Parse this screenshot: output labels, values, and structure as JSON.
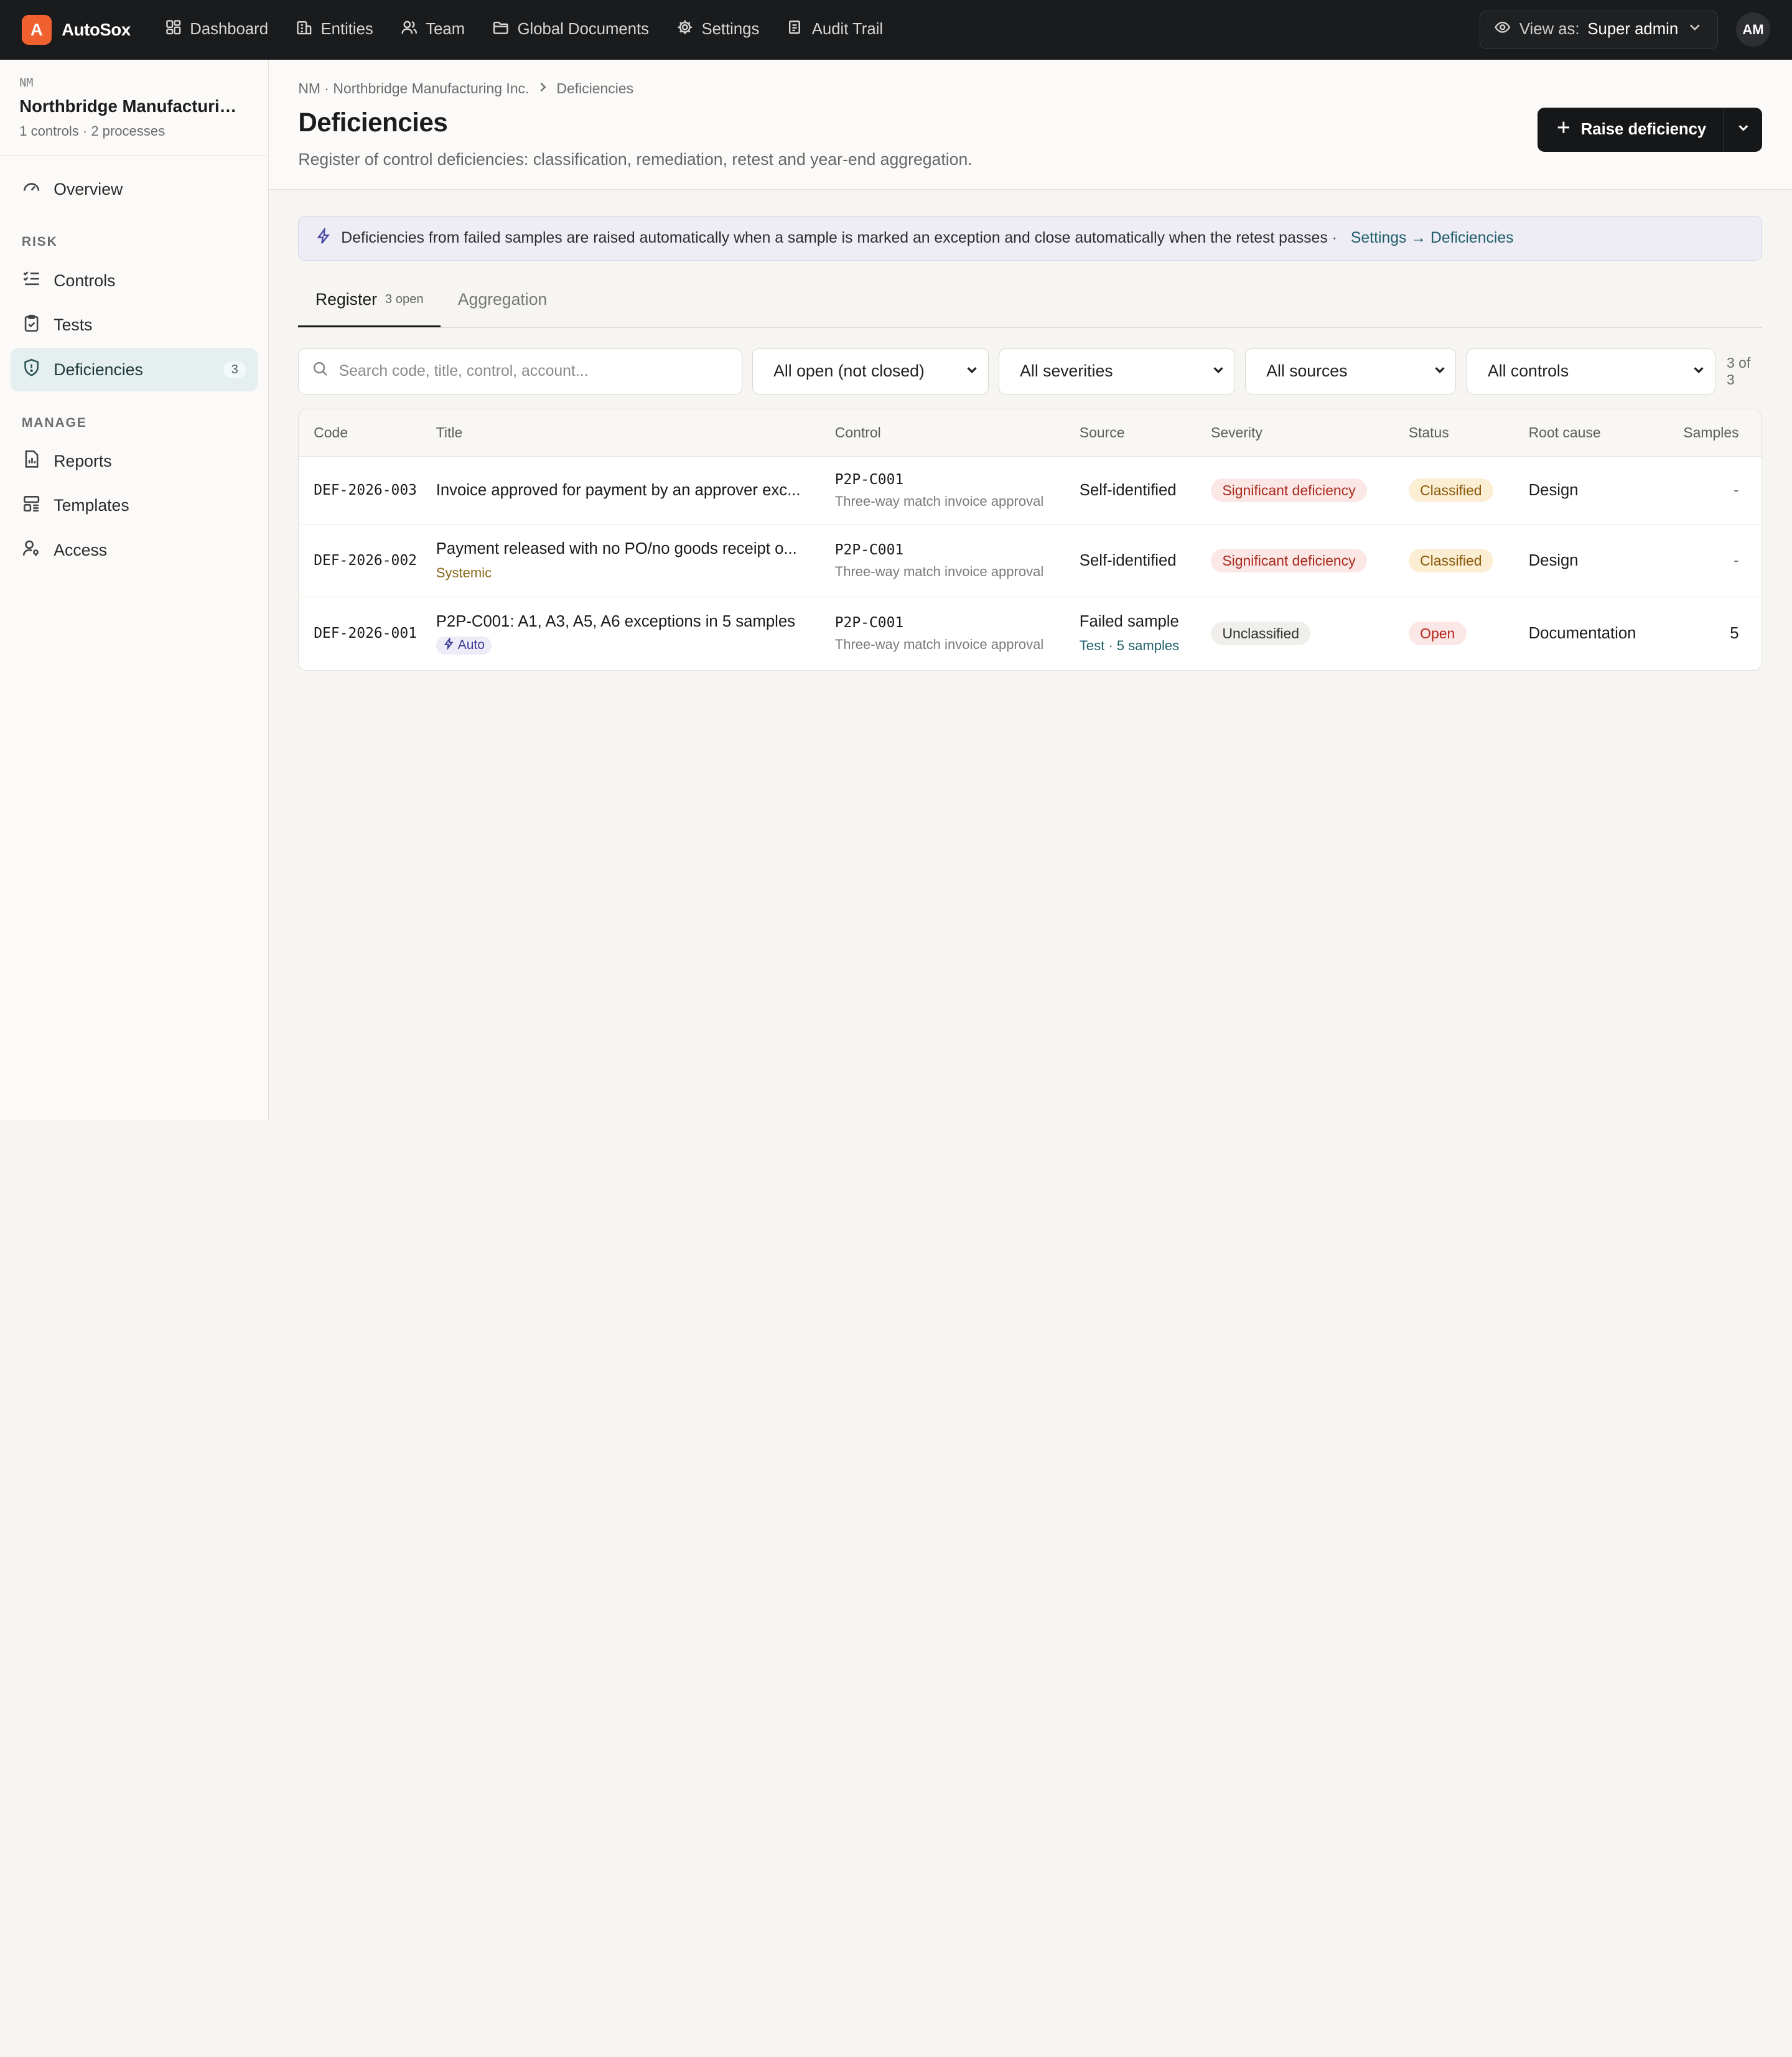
{
  "app": {
    "logo_letter": "A",
    "name": "AutoSox"
  },
  "topnav": [
    {
      "label": "Dashboard",
      "icon": "dashboard-icon"
    },
    {
      "label": "Entities",
      "icon": "building-icon"
    },
    {
      "label": "Team",
      "icon": "users-icon"
    },
    {
      "label": "Global Documents",
      "icon": "folder-icon"
    },
    {
      "label": "Settings",
      "icon": "gear-icon"
    },
    {
      "label": "Audit Trail",
      "icon": "audit-icon"
    }
  ],
  "view_as": {
    "label": "View as:",
    "value": "Super admin"
  },
  "user": {
    "initials": "AM"
  },
  "entity": {
    "code": "NM",
    "name": "Northbridge Manufacturing Inc.",
    "meta": "1 controls · 2 processes"
  },
  "sidebar": {
    "overview": "Overview",
    "risk_label": "RISK",
    "risk_items": [
      {
        "label": "Controls"
      },
      {
        "label": "Tests"
      },
      {
        "label": "Deficiencies",
        "badge": "3"
      }
    ],
    "manage_label": "MANAGE",
    "manage_items": [
      {
        "label": "Reports"
      },
      {
        "label": "Templates"
      },
      {
        "label": "Access"
      }
    ]
  },
  "breadcrumb": {
    "entity": "NM · Northbridge Manufacturing Inc.",
    "current": "Deficiencies"
  },
  "page": {
    "title": "Deficiencies",
    "subtitle": "Register of control deficiencies: classification, remediation, retest and year-end aggregation.",
    "raise_button": "Raise deficiency"
  },
  "banner": {
    "text": "Deficiencies from failed samples are raised automatically when a sample is marked an exception and close automatically when the retest passes ·",
    "link": "Settings → Deficiencies"
  },
  "tabs": [
    {
      "label": "Register",
      "count": "3 open"
    },
    {
      "label": "Aggregation"
    }
  ],
  "filters": {
    "search_placeholder": "Search code, title, control, account...",
    "status": "All open (not closed)",
    "severity": "All severities",
    "source": "All sources",
    "control": "All controls",
    "count": "3 of 3"
  },
  "table": {
    "headers": {
      "code": "Code",
      "title": "Title",
      "control": "Control",
      "source": "Source",
      "severity": "Severity",
      "status": "Status",
      "root_cause": "Root cause",
      "samples": "Samples"
    },
    "rows": [
      {
        "code": "DEF-2026-003",
        "title": "Invoice approved for payment by an approver exc...",
        "tag": "",
        "control_code": "P2P-C001",
        "control_name": "Three-way match invoice approval",
        "source": "Self-identified",
        "source_sub": "",
        "severity": "Significant deficiency",
        "status": "Classified",
        "root_cause": "Design",
        "samples": "-"
      },
      {
        "code": "DEF-2026-002",
        "title": "Payment released with no PO/no goods receipt o...",
        "tag": "Systemic",
        "control_code": "P2P-C001",
        "control_name": "Three-way match invoice approval",
        "source": "Self-identified",
        "source_sub": "",
        "severity": "Significant deficiency",
        "status": "Classified",
        "root_cause": "Design",
        "samples": "-"
      },
      {
        "code": "DEF-2026-001",
        "title": "P2P-C001: A1, A3, A5, A6 exceptions in 5 samples",
        "tag": "Auto",
        "control_code": "P2P-C001",
        "control_name": "Three-way match invoice approval",
        "source": "Failed sample",
        "source_sub": "Test · 5 samples",
        "severity": "Unclassified",
        "status": "Open",
        "root_cause": "Documentation",
        "samples": "5"
      }
    ]
  },
  "colors": {
    "topbar": "#1a1b1d",
    "brand": "#f0612f",
    "active_nav": "#e5efef",
    "link": "#1f5f6b"
  }
}
